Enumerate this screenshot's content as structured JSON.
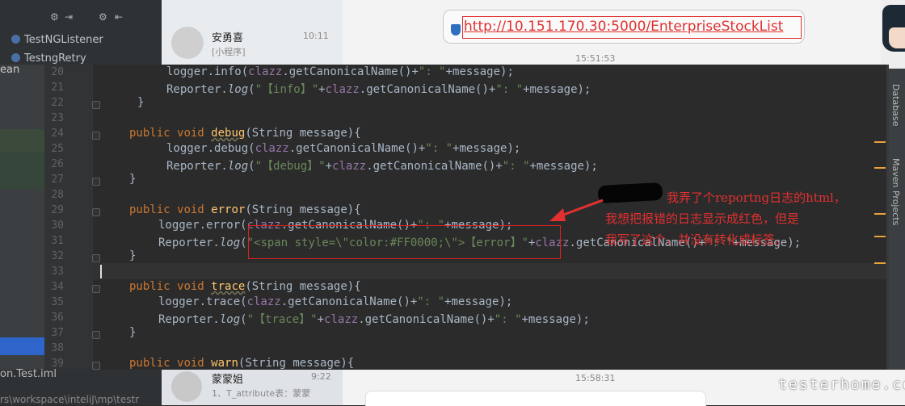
{
  "project_panel": {
    "items": [
      "TestNGListener",
      "TestngRetry"
    ],
    "partial_label": "ean",
    "bottom_label": "on.Test.iml",
    "bottom_path": "rs\\workspace\\inteliJ\\mp\\testr"
  },
  "chat": {
    "contact1_name": "安勇喜",
    "contact1_sub": "[小程序]",
    "contact1_time": "10:11",
    "time_stamp_1": "15:51:53",
    "url": "http://10.151.170.30:5000/EnterpriseStockList",
    "contact2_name": "蒙蒙姐",
    "contact2_time": "9:22",
    "contact2_sub": "1、T_attribute表：蒙蒙",
    "time_stamp_2": "15:58:31"
  },
  "editor": {
    "lines": [
      {
        "n": "20",
        "t": "logger.info(clazz.getCanonicalName()+\": \"+message);"
      },
      {
        "n": "21",
        "t": "Reporter.log(\"【info】\"+clazz.getCanonicalName()+\": \"+message);"
      },
      {
        "n": "22",
        "t": "}"
      },
      {
        "n": "23",
        "t": ""
      },
      {
        "n": "24",
        "t": "public void debug(String message){"
      },
      {
        "n": "25",
        "t": "logger.debug(clazz.getCanonicalName()+\": \"+message);"
      },
      {
        "n": "26",
        "t": "Reporter.log(\"【debug】\"+clazz.getCanonicalName()+\": \"+message);"
      },
      {
        "n": "27",
        "t": "}"
      },
      {
        "n": "28",
        "t": ""
      },
      {
        "n": "29",
        "t": "public void error(String message){"
      },
      {
        "n": "30",
        "t": "logger.error(clazz.getCanonicalName()+\": \"+message);"
      },
      {
        "n": "31",
        "t": "Reporter.log(\"<span style=\\\"color:#FF0000;\\\">【error】\"+clazz.getCanonicalName()+\": \"+message);"
      },
      {
        "n": "32",
        "t": "}"
      },
      {
        "n": "33",
        "t": ""
      },
      {
        "n": "34",
        "t": "public void trace(String message){"
      },
      {
        "n": "35",
        "t": "logger.trace(clazz.getCanonicalName()+\": \"+message);"
      },
      {
        "n": "36",
        "t": "Reporter.log(\"【trace】\"+clazz.getCanonicalName()+\": \"+message);"
      },
      {
        "n": "37",
        "t": "}"
      },
      {
        "n": "38",
        "t": ""
      },
      {
        "n": "39",
        "t": "public void warn(String message){"
      }
    ]
  },
  "tool_windows": [
    "Database",
    "Maven Projects"
  ],
  "annotation": {
    "line1": "我弄了个reportng日志的html，",
    "line2": "我想把报错的日志显示成红色，但是",
    "line3": "我写了这个，并没有转化成标签。"
  },
  "watermark": "testerhome.com",
  "colors": {
    "editor_bg": "#2b2b2b",
    "keyword": "#cc7832",
    "string": "#6a8759",
    "method": "#ffc66d",
    "field": "#9876aa",
    "annotation_red": "#e23030"
  }
}
